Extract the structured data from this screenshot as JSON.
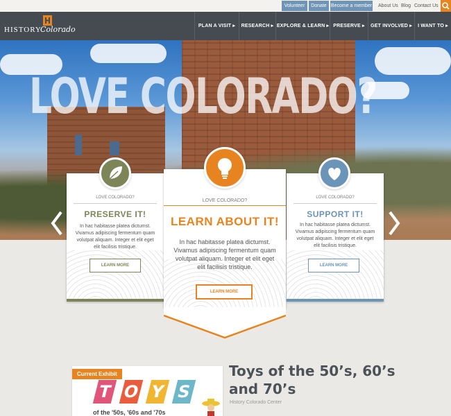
{
  "utility": {
    "buttons": [
      "Volunteer",
      "Donate",
      "Become a member"
    ],
    "links": [
      "About Us",
      "Blog",
      "Contact Us"
    ],
    "search_icon": "search-icon"
  },
  "brand": {
    "logo_word": "HISTORY",
    "logo_script": "Colorado"
  },
  "nav": {
    "items": [
      "PLAN A VISIT ▸",
      "RESEARCH ▸",
      "EXPLORE & LEARN ▸",
      "PRESERVE ▸",
      "GET INVOLVED ▸",
      "I WANT TO ▸"
    ]
  },
  "hero": {
    "title": "LOVE COLORADO?",
    "prev_icon": "chevron-left-icon",
    "next_icon": "chevron-right-icon"
  },
  "cards": {
    "left": {
      "eyebrow": "LOVE COLORADO?",
      "title": "PRESERVE IT!",
      "body": "In hac habitasse platea dictumst. Vivamus adipiscing fermentum quam volutpat aliquam. Integer et elit eget elit facilisis tristique.",
      "button": "LEARN MORE",
      "icon": "leaf-icon",
      "color": "#7d8458"
    },
    "center": {
      "eyebrow": "LOVE COLORADO?",
      "title": "LEARN ABOUT IT!",
      "body": "In hac habitasse platea dictumst. Vivamus adipiscing fermentum quam volutpat aliquam. Integer et elit eget elit facilisis tristique.",
      "button": "LEARN MORE",
      "icon": "lightbulb-icon",
      "color": "#e8841f"
    },
    "right": {
      "eyebrow": "LOVE COLORADO?",
      "title": "SUPPORT IT!",
      "body": "In hac habitasse platea dictumst. Vivamus adipiscing fermentum quam volutpat aliquam. Integer et elit eget elit facilisis tristique.",
      "button": "LEARN MORE",
      "icon": "heart-icon",
      "color": "#6a94b8"
    }
  },
  "exhibit": {
    "tag": "Current Exhibit",
    "image_letters": [
      "T",
      "O",
      "Y",
      "S"
    ],
    "image_subtitle": "of the '50s, '60s and '70s",
    "title": "Toys of the 50’s, 60’s and 70’s",
    "subtitle": "History Colorado Center"
  }
}
